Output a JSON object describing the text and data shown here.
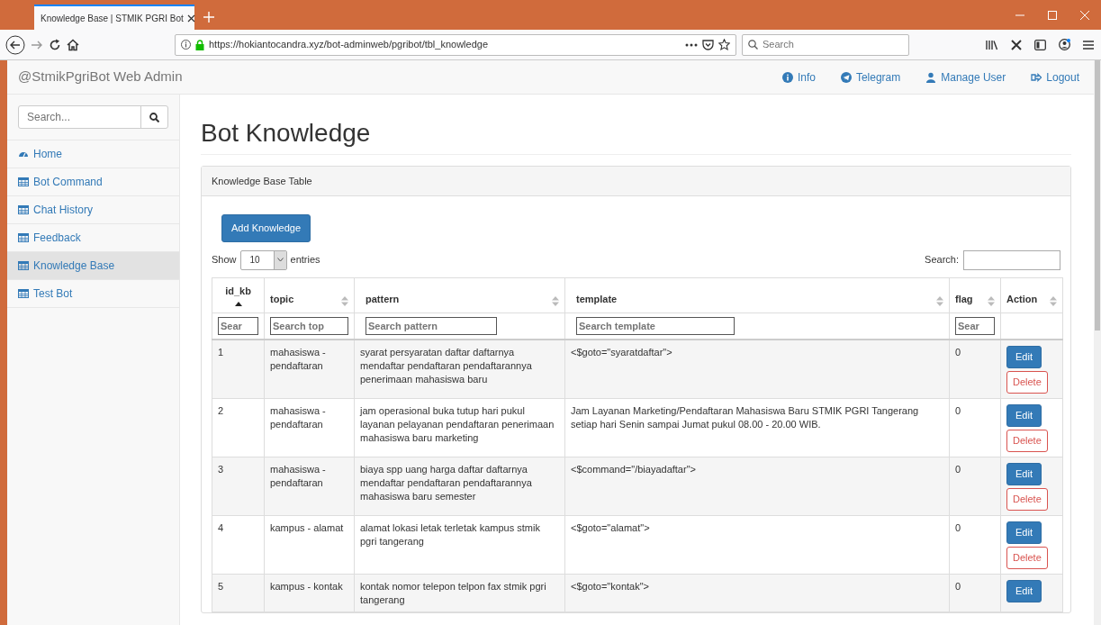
{
  "browser": {
    "tab_title": "Knowledge Base | STMIK PGRI Bot",
    "url": "https://hokiantocandra.xyz/bot-adminweb/pgribot/tbl_knowledge",
    "search_placeholder": "Search"
  },
  "navbar": {
    "brand": "@StmikPgriBot Web Admin",
    "links": [
      {
        "label": "Info"
      },
      {
        "label": "Telegram"
      },
      {
        "label": "Manage User"
      },
      {
        "label": "Logout"
      }
    ]
  },
  "sidebar": {
    "search_placeholder": "Search...",
    "items": [
      {
        "label": "Home",
        "selected": false
      },
      {
        "label": "Bot Command",
        "selected": false
      },
      {
        "label": "Chat History",
        "selected": false
      },
      {
        "label": "Feedback",
        "selected": false
      },
      {
        "label": "Knowledge Base",
        "selected": true
      },
      {
        "label": "Test Bot",
        "selected": false
      }
    ]
  },
  "page": {
    "title": "Bot Knowledge",
    "panel_title": "Knowledge Base Table",
    "add_button": "Add Knowledge",
    "length": {
      "before": "Show",
      "value": "10",
      "after": "entries"
    },
    "search_label": "Search:"
  },
  "table": {
    "columns": [
      {
        "label": "id_kb",
        "sorted": true,
        "placeholder": "Sear"
      },
      {
        "label": "topic",
        "sorted": false,
        "placeholder": "Search top"
      },
      {
        "label": "pattern",
        "sorted": false,
        "placeholder": "Search pattern"
      },
      {
        "label": "template",
        "sorted": false,
        "placeholder": "Search template"
      },
      {
        "label": "flag",
        "sorted": false,
        "placeholder": "Sear"
      },
      {
        "label": "Action",
        "sorted": false
      }
    ],
    "rows": [
      {
        "id": "1",
        "topic": "mahasiswa - pendaftaran",
        "pattern": "syarat persyaratan daftar daftarnya mendaftar pendaftaran pendaftarannya penerimaan mahasiswa baru",
        "template": "<$goto=\"syaratdaftar\">",
        "flag": "0",
        "buttons": [
          {
            "label": "Edit",
            "kind": "edit"
          },
          {
            "label": "Delete",
            "kind": "delete"
          }
        ]
      },
      {
        "id": "2",
        "topic": "mahasiswa - pendaftaran",
        "pattern": "jam operasional buka tutup hari pukul layanan pelayanan pendaftaran penerimaan mahasiswa baru marketing",
        "template": "Jam Layanan Marketing/Pendaftaran Mahasiswa Baru STMIK PGRI Tangerang setiap hari Senin sampai Jumat pukul 08.00 - 20.00 WIB.",
        "flag": "0",
        "buttons": [
          {
            "label": "Edit",
            "kind": "edit"
          },
          {
            "label": "Delete",
            "kind": "delete"
          }
        ]
      },
      {
        "id": "3",
        "topic": "mahasiswa - pendaftaran",
        "pattern": "biaya spp uang harga daftar daftarnya mendaftar pendaftaran pendaftarannya mahasiswa baru semester",
        "template": "<$command=\"/biayadaftar\">",
        "flag": "0",
        "buttons": [
          {
            "label": "Edit",
            "kind": "edit"
          },
          {
            "label": "Delete",
            "kind": "delete"
          }
        ]
      },
      {
        "id": "4",
        "topic": "kampus - alamat",
        "pattern": "alamat lokasi letak terletak kampus stmik pgri tangerang",
        "template": "<$goto=\"alamat\">",
        "flag": "0",
        "buttons": [
          {
            "label": "Edit",
            "kind": "edit"
          },
          {
            "label": "Delete",
            "kind": "delete"
          }
        ]
      },
      {
        "id": "5",
        "topic": "kampus - kontak",
        "pattern": "kontak nomor telepon telpon fax stmik pgri tangerang",
        "template": "<$goto=\"kontak\">",
        "flag": "0",
        "buttons": [
          {
            "label": "Edit",
            "kind": "edit"
          }
        ]
      }
    ]
  }
}
